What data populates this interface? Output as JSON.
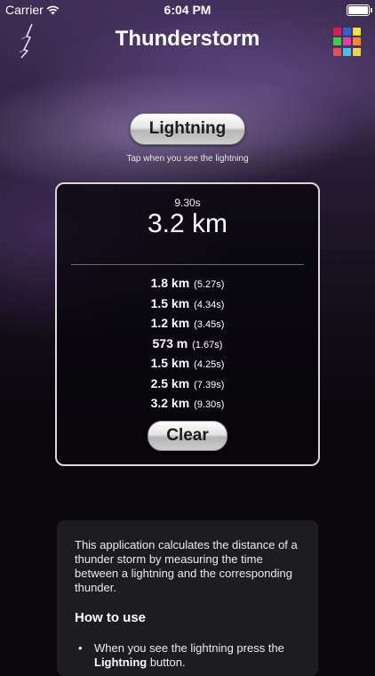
{
  "status_bar": {
    "carrier": "Carrier",
    "time": "6:04 PM"
  },
  "nav": {
    "title": "Thunderstorm"
  },
  "color_palette": [
    "#e4174d",
    "#2a63d9",
    "#efe12d",
    "#35d04c",
    "#e53fa6",
    "#f48a21",
    "#ea4b5c",
    "#3cc6e9",
    "#f7d63c"
  ],
  "main": {
    "lightning_button": "Lightning",
    "hint": "Tap when you see the lightning"
  },
  "result": {
    "last_time": "9.30s",
    "last_distance": "3.2 km",
    "history": [
      {
        "distance": "1.8 km",
        "time": "(5.27s)"
      },
      {
        "distance": "1.5 km",
        "time": "(4.34s)"
      },
      {
        "distance": "1.2 km",
        "time": "(3.45s)"
      },
      {
        "distance": "573 m",
        "time": "(1.67s)"
      },
      {
        "distance": "1.5 km",
        "time": "(4.25s)"
      },
      {
        "distance": "2.5 km",
        "time": "(7.39s)"
      },
      {
        "distance": "3.2 km",
        "time": "(9.30s)"
      }
    ],
    "clear_button": "Clear"
  },
  "help": {
    "intro": "This application calculates the distance of a thunder storm by measuring the time between a lightning and the corresponding thunder.",
    "how_to_heading": "How to use",
    "item_1_prefix": "When you see the lightning press the",
    "item_1_bold": "Lightning",
    "item_1_suffix": "button."
  }
}
